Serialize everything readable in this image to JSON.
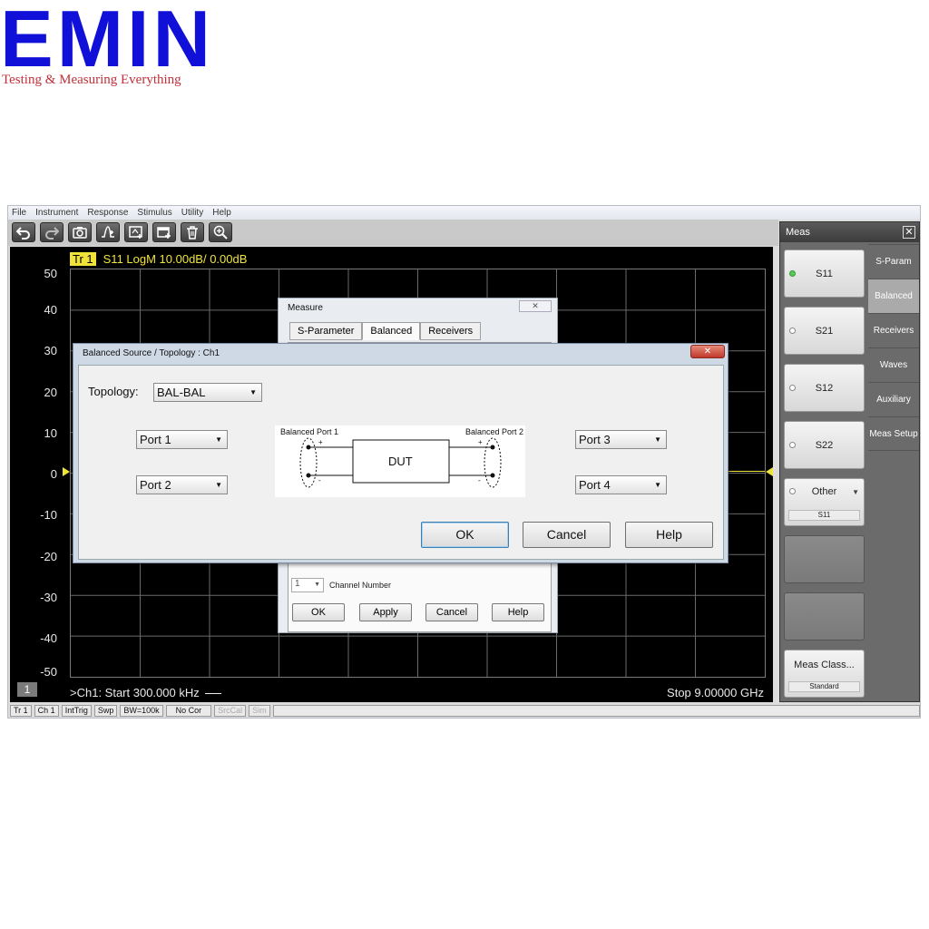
{
  "logo": {
    "brand": "EMIN",
    "tagline": "Testing & Measuring Everything"
  },
  "menu": [
    "File",
    "Instrument",
    "Response",
    "Stimulus",
    "Utility",
    "Help"
  ],
  "toolbar": [
    "undo-icon",
    "redo-icon",
    "camera-icon",
    "marker-icon",
    "add-trace-icon",
    "add-window-icon",
    "trash-icon",
    "zoom-icon"
  ],
  "trace": {
    "badge": "Tr 1",
    "label": "S11 LogM 10.00dB/  0.00dB"
  },
  "yaxis": [
    "50",
    "40",
    "30",
    "20",
    "10",
    "0",
    "-10",
    "-20",
    "-30",
    "-40",
    "-50"
  ],
  "plot": {
    "channel_number": "1",
    "start": ">Ch1:  Start  300.000 kHz",
    "stop": "Stop  9.00000 GHz"
  },
  "meas_panel": {
    "title": "Meas",
    "close": "✕",
    "buttons": [
      {
        "label": "S11",
        "selected": true
      },
      {
        "label": "S21",
        "selected": false
      },
      {
        "label": "S12",
        "selected": false
      },
      {
        "label": "S22",
        "selected": false
      }
    ],
    "other": {
      "label": "Other",
      "sub": "S11"
    },
    "meas_class": {
      "label": "Meas Class...",
      "sub": "Standard"
    },
    "tabs": [
      "S-Param",
      "Balanced",
      "Receivers",
      "Waves",
      "Auxiliary",
      "Meas Setup"
    ],
    "active_tab": "Balanced"
  },
  "status": [
    {
      "label": "Tr 1",
      "dim": false
    },
    {
      "label": "Ch 1",
      "dim": false
    },
    {
      "label": "IntTrig",
      "dim": false
    },
    {
      "label": "Swp",
      "dim": false
    },
    {
      "label": "BW=100k",
      "dim": false
    },
    {
      "label": "No Cor",
      "dim": false
    },
    {
      "label": "SrcCal",
      "dim": true
    },
    {
      "label": "Sim",
      "dim": true
    }
  ],
  "measure_dialog": {
    "title": "Measure",
    "close": "✕",
    "tabs": [
      "S-Parameter",
      "Balanced",
      "Receivers"
    ],
    "active_tab": "Balanced",
    "channel_value": "1",
    "channel_label": "Channel Number",
    "buttons": {
      "ok": "OK",
      "apply": "Apply",
      "cancel": "Cancel",
      "help": "Help"
    }
  },
  "balanced_dialog": {
    "title": "Balanced Source / Topology : Ch1",
    "close": "✕",
    "topology_label": "Topology:",
    "topology_value": "BAL-BAL",
    "port_left_1": "Port 1",
    "port_left_2": "Port 2",
    "port_right_1": "Port 3",
    "port_right_2": "Port 4",
    "diagram": {
      "left_label": "Balanced Port 1",
      "right_label": "Balanced Port 2",
      "dut": "DUT",
      "plus": "+",
      "minus": "-"
    },
    "buttons": {
      "ok": "OK",
      "cancel": "Cancel",
      "help": "Help"
    }
  }
}
